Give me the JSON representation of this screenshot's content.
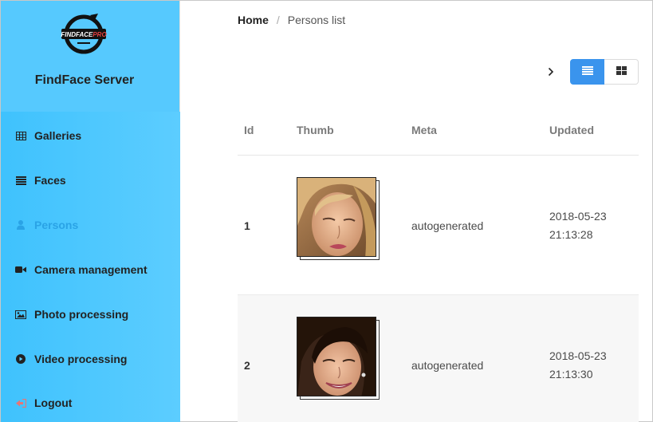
{
  "brand": {
    "logo_text": "FINDFACE PRO",
    "title": "FindFace Server"
  },
  "sidebar": {
    "items": [
      {
        "label": "Galleries",
        "icon": "table-icon"
      },
      {
        "label": "Faces",
        "icon": "list-icon"
      },
      {
        "label": "Persons",
        "icon": "user-icon",
        "active": true
      },
      {
        "label": "Camera management",
        "icon": "video-camera-icon"
      },
      {
        "label": "Photo processing",
        "icon": "image-icon"
      },
      {
        "label": "Video processing",
        "icon": "play-circle-icon"
      },
      {
        "label": "Logout",
        "icon": "sign-out-icon"
      }
    ]
  },
  "breadcrumb": {
    "home": "Home",
    "separator": "/",
    "current": "Persons list"
  },
  "toolbar": {
    "view_mode": "list",
    "accent": "#3a94ed"
  },
  "table": {
    "columns": [
      "Id",
      "Thumb",
      "Meta",
      "Updated"
    ],
    "rows": [
      {
        "id": "1",
        "meta": "autogenerated",
        "updated_date": "2018-05-23",
        "updated_time": "21:13:28"
      },
      {
        "id": "2",
        "meta": "autogenerated",
        "updated_date": "2018-05-23",
        "updated_time": "21:13:30"
      }
    ]
  }
}
